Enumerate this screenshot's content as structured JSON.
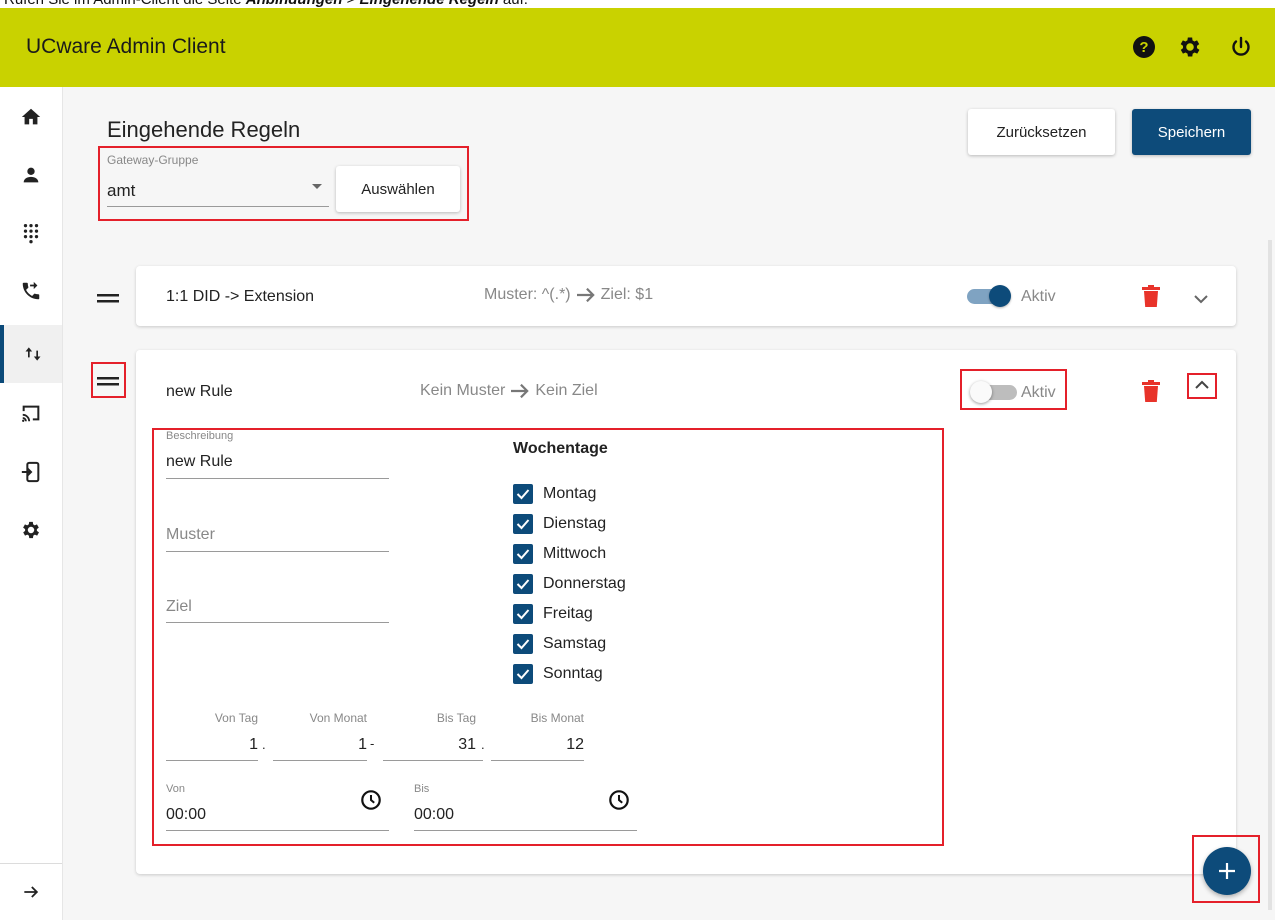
{
  "caption": {
    "prefix": "Rufen Sie im Admin-Client die Seite ",
    "path1": "Anbindungen",
    "sep": " > ",
    "path2": "Eingehende Regeln",
    "suffix": " auf."
  },
  "header": {
    "title": "UCware Admin Client",
    "icons": [
      "help-icon",
      "settings-icon",
      "power-icon"
    ]
  },
  "sidebar": {
    "items": [
      {
        "icon": "home-icon"
      },
      {
        "icon": "user-icon"
      },
      {
        "icon": "dialpad-icon"
      },
      {
        "icon": "call-forward-icon"
      },
      {
        "icon": "in-out-arrows-icon",
        "active": true
      },
      {
        "icon": "cast-icon"
      },
      {
        "icon": "device-login-icon"
      },
      {
        "icon": "gear-icon"
      }
    ],
    "collapse_icon": "arrow-right-icon"
  },
  "page": {
    "title": "Eingehende Regeln",
    "reset_label": "Zurücksetzen",
    "save_label": "Speichern"
  },
  "gateway": {
    "label": "Gateway-Gruppe",
    "value": "amt",
    "select_label": "Auswählen"
  },
  "rules": [
    {
      "name": "1:1 DID -> Extension",
      "pattern_text": "Muster: ^(.*)",
      "target_text": "Ziel: $1",
      "active_label": "Aktiv",
      "active": true,
      "expanded": false
    },
    {
      "name": "new Rule",
      "pattern_text": "Kein Muster",
      "target_text": "Kein Ziel",
      "active_label": "Aktiv",
      "active": false,
      "expanded": true
    }
  ],
  "editor": {
    "description_label": "Beschreibung",
    "description_value": "new Rule",
    "pattern_placeholder": "Muster",
    "target_placeholder": "Ziel",
    "weekdays_title": "Wochentage",
    "weekdays": [
      {
        "label": "Montag",
        "checked": true
      },
      {
        "label": "Dienstag",
        "checked": true
      },
      {
        "label": "Mittwoch",
        "checked": true
      },
      {
        "label": "Donnerstag",
        "checked": true
      },
      {
        "label": "Freitag",
        "checked": true
      },
      {
        "label": "Samstag",
        "checked": true
      },
      {
        "label": "Sonntag",
        "checked": true
      }
    ],
    "date": {
      "from_day_label": "Von Tag",
      "from_day_value": "1",
      "from_month_label": "Von Monat",
      "from_month_value": "1",
      "to_day_label": "Bis Tag",
      "to_day_value": "31",
      "to_month_label": "Bis Monat",
      "to_month_value": "12",
      "dot": ".",
      "dash": "-"
    },
    "time": {
      "from_label": "Von",
      "from_value": "00:00",
      "to_label": "Bis",
      "to_value": "00:00"
    }
  },
  "colors": {
    "header_bg": "#c9d200",
    "primary": "#0d4b7a",
    "danger": "#e8332a",
    "highlight": "#e4202a"
  }
}
